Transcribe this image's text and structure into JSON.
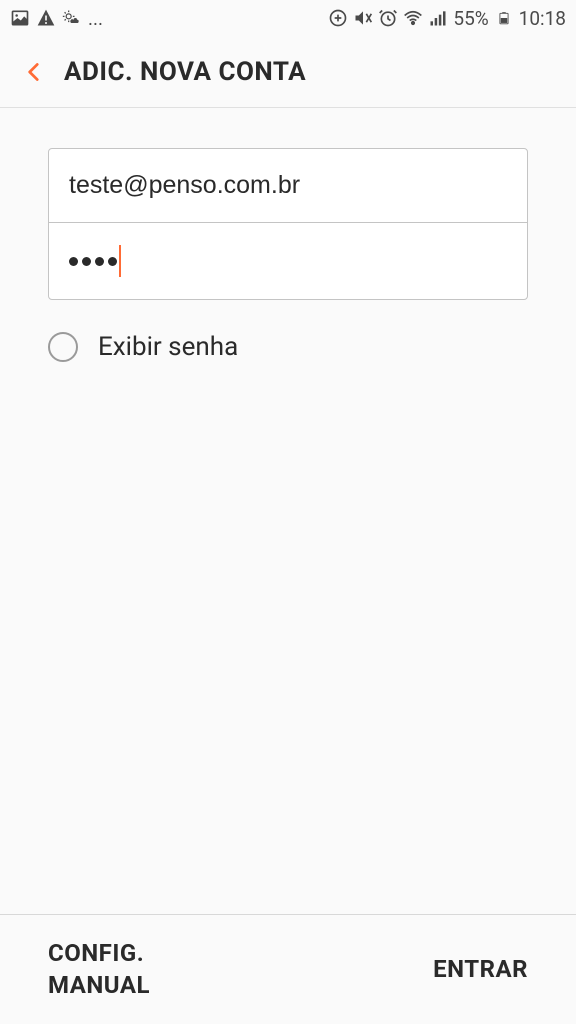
{
  "status_bar": {
    "battery_percent": "55%",
    "time": "10:18",
    "ellipsis": "..."
  },
  "header": {
    "title": "ADIC. NOVA CONTA"
  },
  "form": {
    "email_value": "teste@penso.com.br",
    "password_dots": 4,
    "show_password_label": "Exibir senha"
  },
  "footer": {
    "manual_config_line1": "CONFIG.",
    "manual_config_line2": "MANUAL",
    "enter_label": "ENTRAR"
  },
  "colors": {
    "accent": "#ff6b35"
  }
}
